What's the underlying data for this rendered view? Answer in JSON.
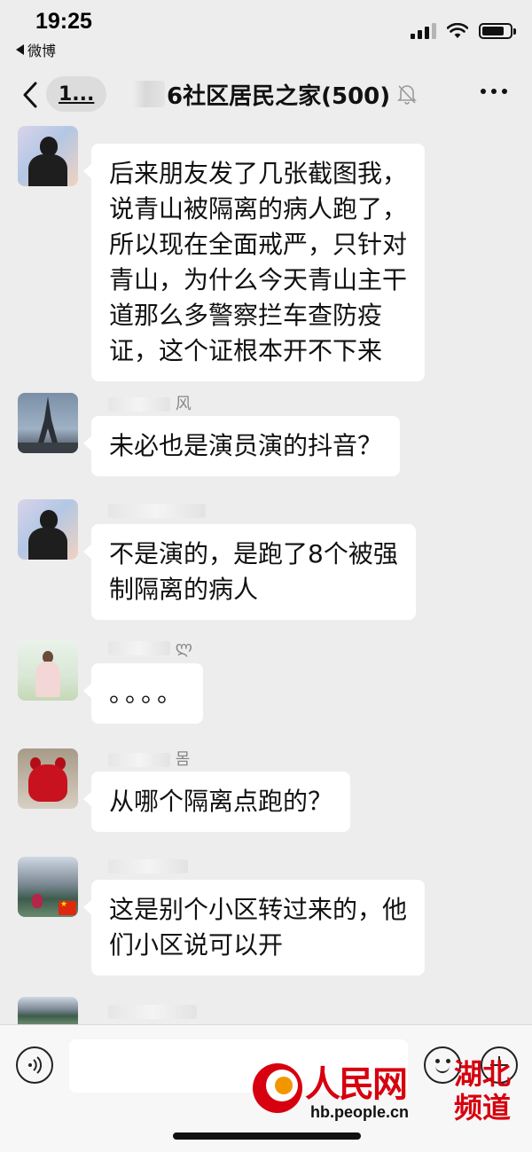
{
  "status_bar": {
    "time": "19:25",
    "back_app": "微博"
  },
  "nav": {
    "unread": "1...",
    "title": "6社区居民之家(500)"
  },
  "messages": [
    {
      "avatar": "person-silhouette",
      "sender": "",
      "lines": [
        "后来朋友发了几张截图我，",
        "说青山被隔离的病人跑了，",
        "所以现在全面戒严，只针对",
        "青山，为什么今天青山主干",
        "道那么多警察拦车查防疫",
        "证，这个证根本开不下来"
      ]
    },
    {
      "avatar": "eiffel-tower",
      "sender": "风",
      "lines": [
        "未必也是演员演的抖音？"
      ]
    },
    {
      "avatar": "person-silhouette",
      "sender": "",
      "lines": [
        "不是演的，是跑了8个被强",
        "制隔离的病人"
      ]
    },
    {
      "avatar": "girl-in-dress",
      "sender": "ლ",
      "lines": [
        "。。。。"
      ]
    },
    {
      "avatar": "red-dog-statue",
      "sender": "몸",
      "lines": [
        "从哪个隔离点跑的？"
      ]
    },
    {
      "avatar": "mountain-lake",
      "sender": "",
      "lines": [
        "这是别个小区转过来的，他",
        "们小区说可以开"
      ]
    }
  ],
  "watermark": {
    "brand": "人民网",
    "url": "hb.people.cn",
    "channel_line1": "湖北",
    "channel_line2": "频道"
  },
  "colors": {
    "background": "#ededed",
    "bubble": "#ffffff",
    "brand_red": "#d7000f"
  },
  "icons": [
    "back-chevron-icon",
    "mute-bell-icon",
    "more-icon",
    "voice-icon",
    "emoji-icon",
    "plus-icon",
    "signal-icon",
    "wifi-icon",
    "battery-icon"
  ]
}
